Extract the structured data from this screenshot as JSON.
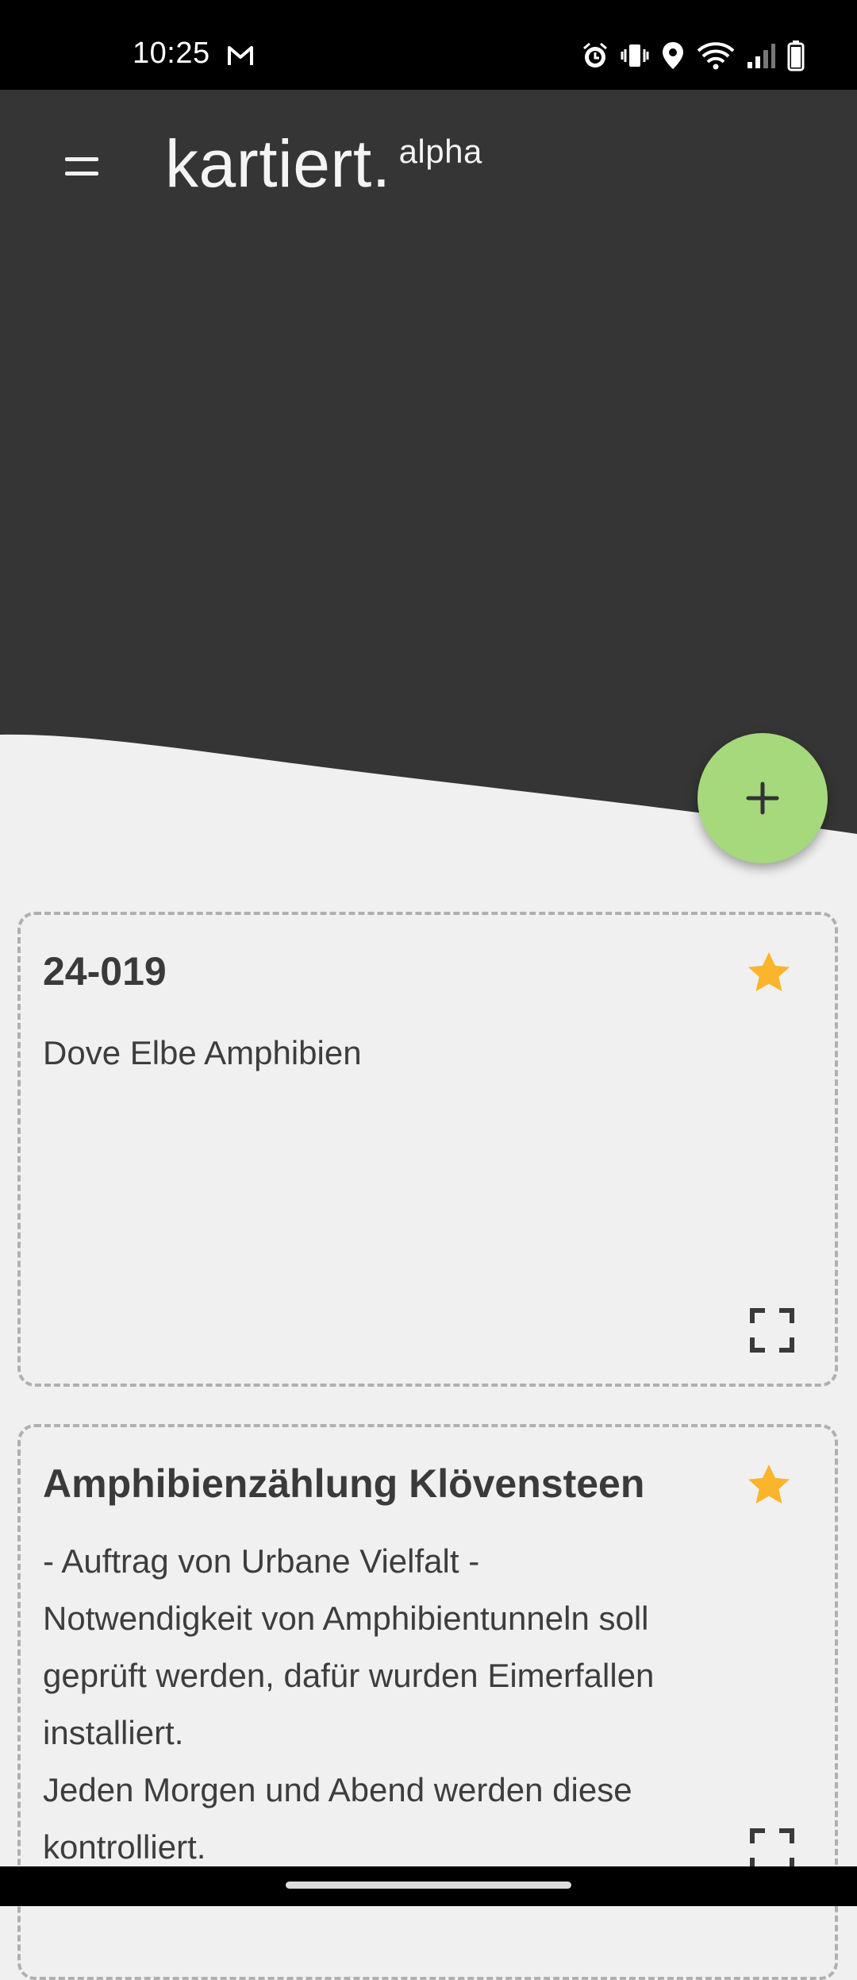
{
  "status_bar": {
    "time": "10:25",
    "icons": [
      "gmail-icon",
      "alarm-icon",
      "vibrate-icon",
      "location-icon",
      "wifi-icon",
      "signal-icon",
      "battery-icon"
    ]
  },
  "header": {
    "menu_icon": "menu-icon",
    "title": "kartiert.",
    "title_suffix": "alpha",
    "background_color": "#353535"
  },
  "fab": {
    "icon": "plus-icon",
    "color": "#a5d97c"
  },
  "projects": [
    {
      "title": "24-019",
      "description": "Dove Elbe Amphibien",
      "starred": true,
      "star_color": "#fbb52c"
    },
    {
      "title": "Amphibienzählung Klövensteen",
      "description": "- Auftrag von Urbane Vielfalt -\nNotwendigkeit von Amphibientunneln soll geprüft werden, dafür wurden Eimerfallen installiert.\nJeden Morgen und Abend werden diese kontrolliert.",
      "starred": true,
      "star_color": "#fbb52c"
    }
  ]
}
